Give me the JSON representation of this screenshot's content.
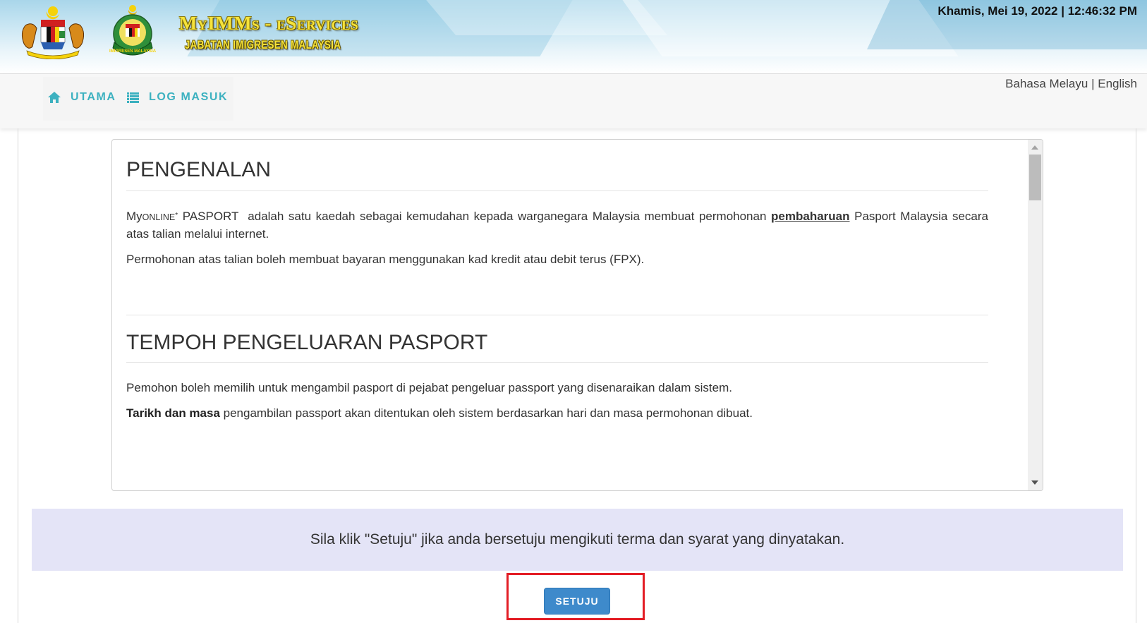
{
  "header": {
    "brand_title": "MyIMMs - eServices",
    "brand_subtitle": "JABATAN IMIGRESEN MALAYSIA",
    "datetime": "Khamis, Mei 19, 2022 | 12:46:32 PM",
    "logos": [
      "malaysia-coat-of-arms",
      "imigresen-malaysia-emblem"
    ]
  },
  "nav": {
    "items": [
      {
        "label": "UTAMA",
        "icon": "home-icon"
      },
      {
        "label": "LOG MASUK",
        "icon": "list-icon"
      }
    ],
    "languages": {
      "malay": "Bahasa Melayu",
      "separator": "|",
      "english": "English"
    }
  },
  "terms": {
    "sections": [
      {
        "title": "PENGENALAN",
        "p1_brand_prefix": "My",
        "p1_brand_online": "online",
        "p1_brand_star": "*",
        "p1_brand_suffix": " PASPORT",
        "p1_text_before": "  adalah satu kaedah sebagai kemudahan kepada warganegara Malaysia membuat permohonan ",
        "p1_link": "pembaharuan",
        "p1_text_after": " Pasport Malaysia secara atas talian melalui internet.",
        "p2": "Permohonan atas talian boleh membuat bayaran menggunakan kad kredit atau debit terus (FPX)."
      },
      {
        "title": "TEMPOH PENGELUARAN PASPORT",
        "p1": "Pemohon boleh memilih untuk mengambil pasport di pejabat pengeluar passport yang disenaraikan dalam sistem.",
        "p2_bold": "Tarikh dan masa",
        "p2_rest": " pengambilan passport akan ditentukan oleh sistem berdasarkan hari dan masa permohonan dibuat."
      }
    ],
    "scroll_position_fraction": 0.0
  },
  "notice": "Sila klik \"Setuju\" jika anda bersetuju mengikuti terma dan syarat yang dinyatakan.",
  "actions": {
    "agree_label": "SETUJU"
  },
  "colors": {
    "nav_accent": "#3cb1c0",
    "button": "#3e8acb",
    "notice_bg": "#e4e4f7",
    "highlight": "#e31d25"
  }
}
